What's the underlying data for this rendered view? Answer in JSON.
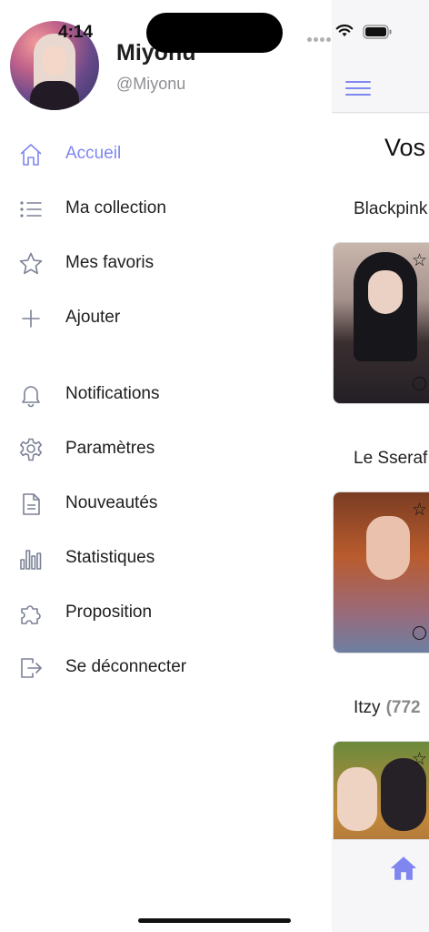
{
  "status_bar": {
    "time": "4:14"
  },
  "profile": {
    "name": "Miyonu",
    "handle": "@Miyonu"
  },
  "menu": {
    "items": [
      {
        "label": "Accueil",
        "icon": "home-icon",
        "active": true
      },
      {
        "label": "Ma collection",
        "icon": "list-icon"
      },
      {
        "label": "Mes favoris",
        "icon": "star-icon"
      },
      {
        "label": "Ajouter",
        "icon": "plus-icon"
      },
      {
        "label": "Notifications",
        "icon": "bell-icon"
      },
      {
        "label": "Paramètres",
        "icon": "gear-icon"
      },
      {
        "label": "Nouveautés",
        "icon": "document-icon"
      },
      {
        "label": "Statistiques",
        "icon": "bar-chart-icon"
      },
      {
        "label": "Proposition",
        "icon": "puzzle-icon"
      },
      {
        "label": "Se déconnecter",
        "icon": "logout-icon"
      }
    ]
  },
  "main": {
    "heading": "Vos",
    "groups": [
      {
        "name": "Blackpink",
        "count": ""
      },
      {
        "name": "Le Sseraf",
        "count": ""
      },
      {
        "name": "Itzy",
        "count": "(772"
      }
    ]
  },
  "colors": {
    "accent": "#7f86f0",
    "icon": "#7b8196",
    "text": "#1e1e1e",
    "muted": "#8e8e93"
  }
}
